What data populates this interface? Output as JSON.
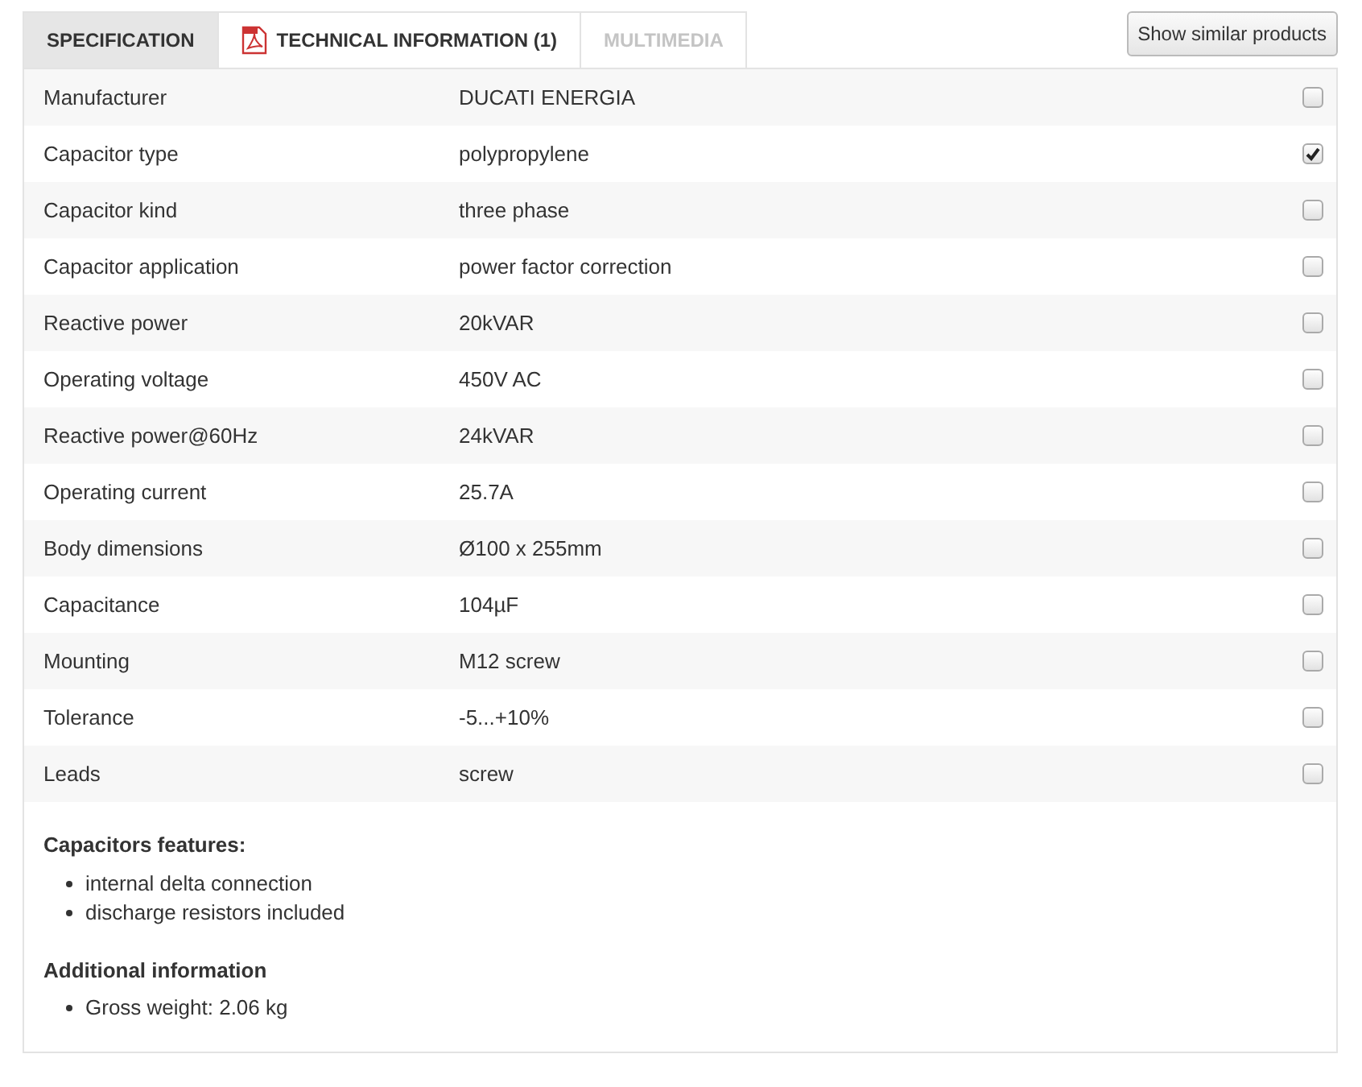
{
  "tabs": [
    {
      "label": "SPECIFICATION",
      "kind": "plain",
      "selected": true,
      "disabled": false
    },
    {
      "label": "TECHNICAL INFORMATION (1)",
      "kind": "document",
      "selected": false,
      "disabled": false
    },
    {
      "label": "MULTIMEDIA",
      "kind": "plain",
      "selected": false,
      "disabled": true
    }
  ],
  "similar_button": "Show similar products",
  "specs": [
    {
      "name": "Manufacturer",
      "value": "DUCATI ENERGIA",
      "checked": false
    },
    {
      "name": "Capacitor type",
      "value": "polypropylene",
      "checked": true
    },
    {
      "name": "Capacitor kind",
      "value": "three phase",
      "checked": false
    },
    {
      "name": "Capacitor application",
      "value": "power factor correction",
      "checked": false
    },
    {
      "name": "Reactive power",
      "value": "20kVAR",
      "checked": false
    },
    {
      "name": "Operating voltage",
      "value": "450V AC",
      "checked": false
    },
    {
      "name": "Reactive power@60Hz",
      "value": "24kVAR",
      "checked": false
    },
    {
      "name": "Operating current",
      "value": "25.7A",
      "checked": false
    },
    {
      "name": "Body dimensions",
      "value": "Ø100 x 255mm",
      "checked": false
    },
    {
      "name": "Capacitance",
      "value": "104µF",
      "checked": false
    },
    {
      "name": "Mounting",
      "value": "M12 screw",
      "checked": false
    },
    {
      "name": "Tolerance",
      "value": "-5...+10%",
      "checked": false
    },
    {
      "name": "Leads",
      "value": "screw",
      "checked": false
    }
  ],
  "sections": [
    {
      "heading": "Capacitors features:",
      "items": [
        "internal delta connection",
        "discharge resistors included"
      ]
    },
    {
      "heading": "Additional information",
      "items": [
        "Gross weight: 2.06 kg"
      ]
    }
  ]
}
